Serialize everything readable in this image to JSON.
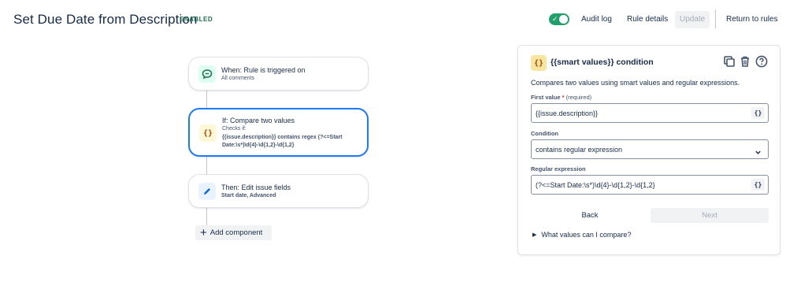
{
  "header": {
    "title": "Set Due Date from Description",
    "status_badge": "ENABLED",
    "toggle_on": true,
    "toggle_check": "✓",
    "actions": {
      "audit_log": "Audit log",
      "rule_details": "Rule details",
      "update": "Update",
      "return_to_rules": "Return to rules"
    }
  },
  "flow": {
    "trigger": {
      "title": "When: Rule is triggered on",
      "subtitle": "All comments",
      "icon": "comment-icon",
      "icon_bg": "#dcfff1",
      "icon_color": "#216e4e"
    },
    "condition": {
      "title": "If: Compare two values",
      "subtitle": "Checks if:",
      "detail": "{{issue.description}} contains regex (?<=Start Date:\\s*)\\d{4}-\\d{1,2}-\\d{1,2}",
      "icon": "braces-icon",
      "icon_glyph": "{}",
      "icon_bg": "#fff7d6",
      "icon_color": "#a54800"
    },
    "action": {
      "title": "Then: Edit issue fields",
      "subtitle": "Start date, Advanced",
      "icon": "pencil-icon",
      "icon_bg": "#e9f2ff",
      "icon_color": "#0c66e4"
    },
    "add_component": {
      "plus": "+",
      "label": "Add component"
    }
  },
  "panel": {
    "icon_glyph": "{}",
    "title": "{{smart values}} condition",
    "description": "Compares two values using smart values and regular expressions.",
    "first_value": {
      "label": "First value",
      "required_mark": "*",
      "required_text": "(required)",
      "value": "{{issue.description}}",
      "sv_button": "{}"
    },
    "condition": {
      "label": "Condition",
      "value": "contains regular expression"
    },
    "regex": {
      "label": "Regular expression",
      "value": "(?<=Start Date:\\s*)\\d{4}-\\d{1,2}-\\d{1,2}",
      "sv_button": "{}"
    },
    "back": "Back",
    "next": "Next",
    "more_caret": "▶",
    "more": "What values can I compare?"
  },
  "colors": {
    "accent": "#1d7afc",
    "toggle": "#22a06b",
    "enabled": "#216e4e"
  }
}
